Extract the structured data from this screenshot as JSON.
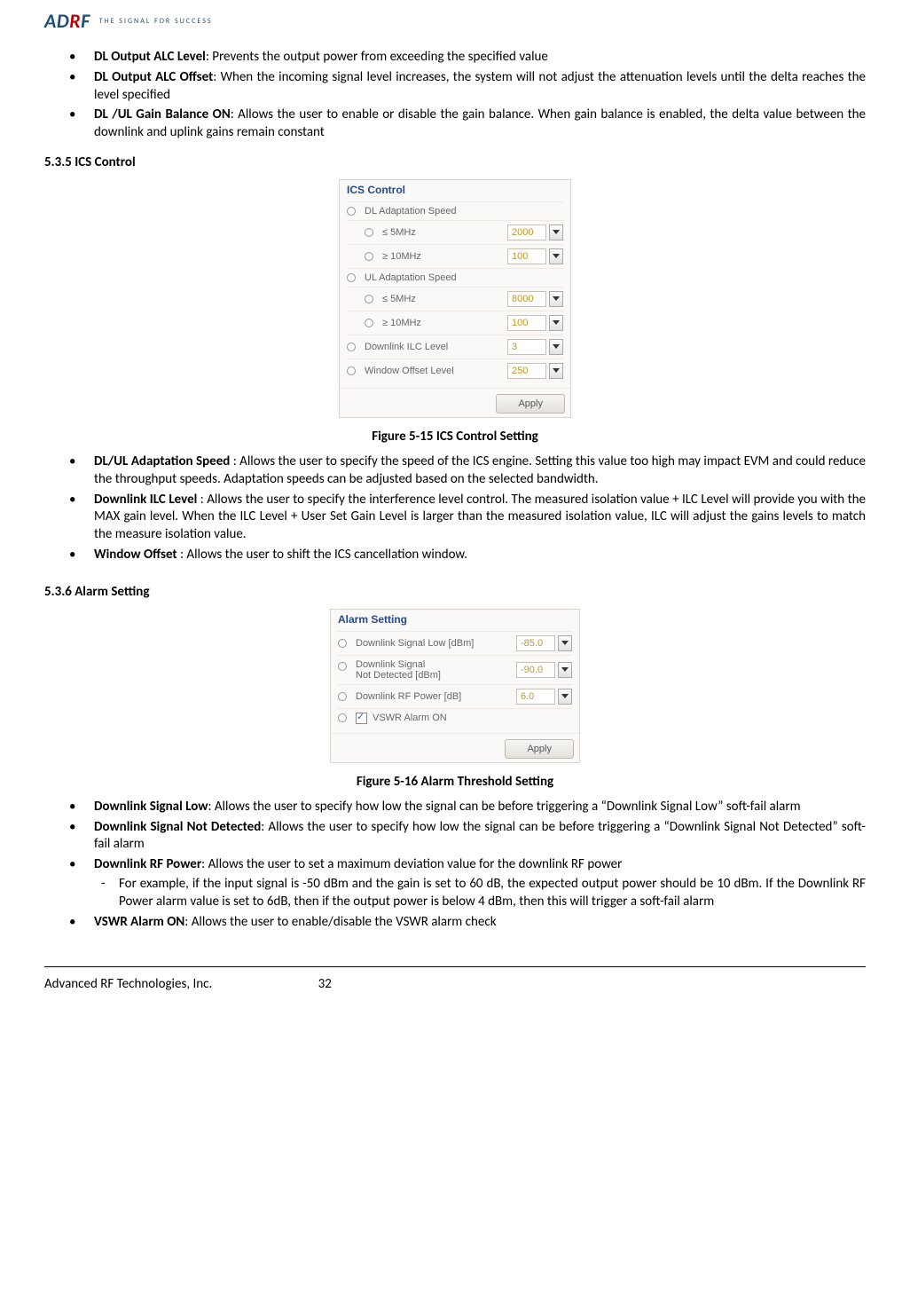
{
  "header": {
    "logo_ad": "AD",
    "logo_r": "R",
    "logo_f": "F",
    "tagline": "THE SIGNAL FOR SUCCESS"
  },
  "list1": {
    "alc_level_label": "DL Output ALC Level",
    "alc_level_text": ": Prevents the output power from exceeding the specified value",
    "alc_offset_label": "DL Output ALC Offset",
    "alc_offset_text": ": When the incoming signal level increases, the system will not adjust the attenuation levels until the delta reaches the level specified",
    "gain_balance_label": "DL /UL Gain Balance ON",
    "gain_balance_text": ": Allows the user to enable or disable the gain balance.  When gain balance is enabled, the delta value between the downlink and uplink gains remain constant"
  },
  "section535_heading": "5.3.5   ICS Control",
  "ics_panel": {
    "title": "ICS Control",
    "dl_speed_label": "DL Adaptation Speed",
    "dl_5mhz_label": "≤ 5MHz",
    "dl_5mhz_value": "2000",
    "dl_10mhz_label": "≥ 10MHz",
    "dl_10mhz_value": "100",
    "ul_speed_label": "UL Adaptation Speed",
    "ul_5mhz_label": "≤ 5MHz",
    "ul_5mhz_value": "8000",
    "ul_10mhz_label": "≥ 10MHz",
    "ul_10mhz_value": "100",
    "ilc_label": "Downlink ILC Level",
    "ilc_value": "3",
    "window_label": "Window Offset Level",
    "window_value": "250",
    "apply_label": "Apply"
  },
  "figure515_caption": "Figure 5-15   ICS Control Setting",
  "list2": {
    "adapt_label": "DL/UL Adaptation Speed",
    "adapt_text": " : Allows the user to specify the speed of the ICS engine.  Setting this value too high may impact EVM and could reduce the throughput speeds.  Adaptation speeds can be adjusted based on the selected bandwidth.",
    "ilc_label": "Downlink ILC Level",
    "ilc_text": " : Allows the user to specify the interference level control.  The measured isolation value + ILC Level will provide you with the MAX gain level.  When the ILC Level + User Set Gain Level is larger than the measured isolation value, ILC will adjust the gains levels to match the measure isolation value.",
    "window_label": "Window Offset",
    "window_text": " : Allows the user to shift the ICS cancellation window."
  },
  "section536_heading": "5.3.6   Alarm Setting",
  "alarm_panel": {
    "title": "Alarm Setting",
    "sig_low_label": "Downlink Signal Low [dBm]",
    "sig_low_value": "-85.0",
    "not_det_label_a": "Downlink Signal",
    "not_det_label_b": "Not Detected [dBm]",
    "not_det_value": "-90.0",
    "rf_power_label": "Downlink RF Power [dB]",
    "rf_power_value": "6.0",
    "vswr_label": "VSWR Alarm ON",
    "apply_label": "Apply"
  },
  "figure516_caption": "Figure 5-16   Alarm Threshold Setting",
  "list3": {
    "sig_low_label": "Downlink Signal Low",
    "sig_low_text": ": Allows the user to specify how low the signal can be before triggering a “Downlink Signal Low” soft-fail alarm",
    "not_det_label": "Downlink Signal Not Detected",
    "not_det_text": ": Allows the user to specify how low the signal can be before triggering a “Downlink Signal Not Detected” soft-fail alarm",
    "rf_power_label": "Downlink RF Power",
    "rf_power_text": ": Allows the user to set a maximum deviation value for the downlink RF power",
    "rf_power_sub": "For example, if the input signal is -50 dBm and the gain is set to 60 dB, the expected output power should be 10 dBm.  If the Downlink RF Power alarm value is set to 6dB, then if the output power is below 4 dBm, then this will trigger a soft-fail alarm",
    "vswr_label": "VSWR Alarm ON",
    "vswr_text": ": Allows the user to enable/disable the VSWR alarm check"
  },
  "footer": {
    "company": "Advanced RF Technologies, Inc.",
    "page": "32"
  }
}
